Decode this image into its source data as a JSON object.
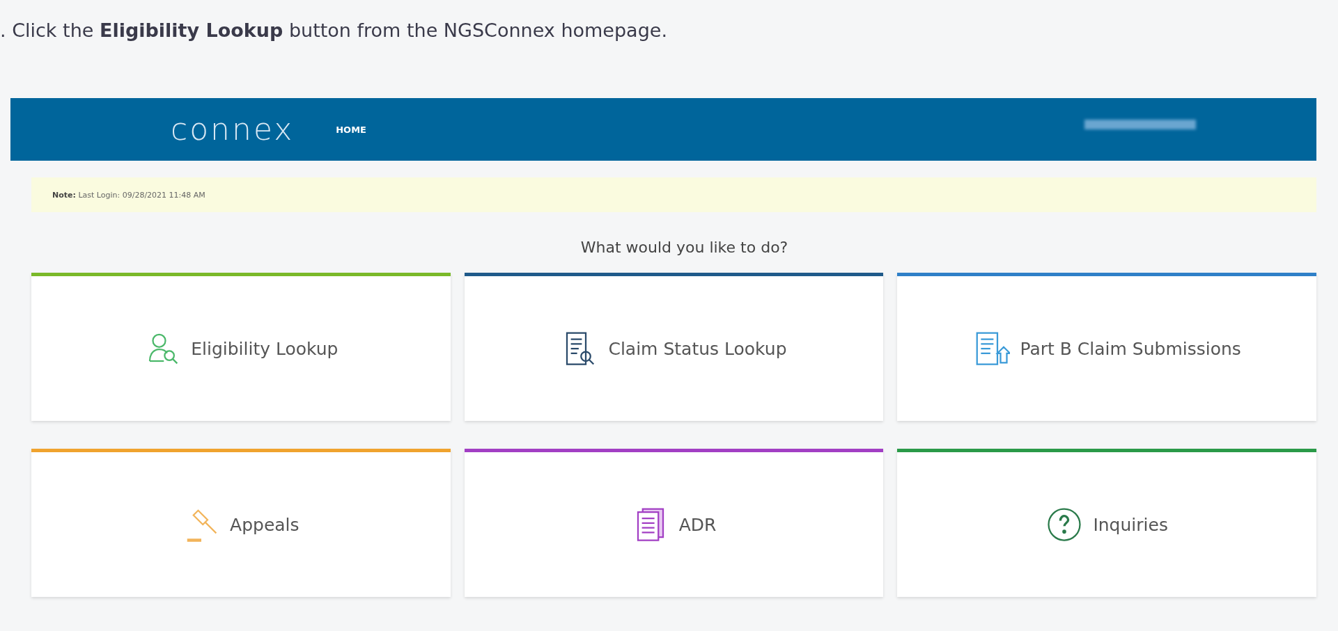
{
  "instruction": ". Click the **Eligibility Lookup** button from the NGSConnex homepage.",
  "header": {
    "logo": "connex",
    "nav": [
      "HOME"
    ]
  },
  "notice": {
    "label": "Note:",
    "text": "Last Login: 09/28/2021 11:48 AM"
  },
  "prompt": "What would you like to do?",
  "tiles": [
    {
      "label": "Eligibility Lookup",
      "kind": "person",
      "color": "#7ab929"
    },
    {
      "label": "Claim Status Lookup",
      "kind": "document-search",
      "color": "#1f5a8a"
    },
    {
      "label": "Part B Claim Submissions",
      "kind": "document-upload",
      "color": "#2f80c8"
    },
    {
      "label": "Appeals",
      "kind": "gavel",
      "color": "#f0a32e"
    },
    {
      "label": "ADR",
      "kind": "documents",
      "color": "#a23fc4"
    },
    {
      "label": "Inquiries",
      "kind": "question",
      "color": "#2a9a48"
    }
  ]
}
